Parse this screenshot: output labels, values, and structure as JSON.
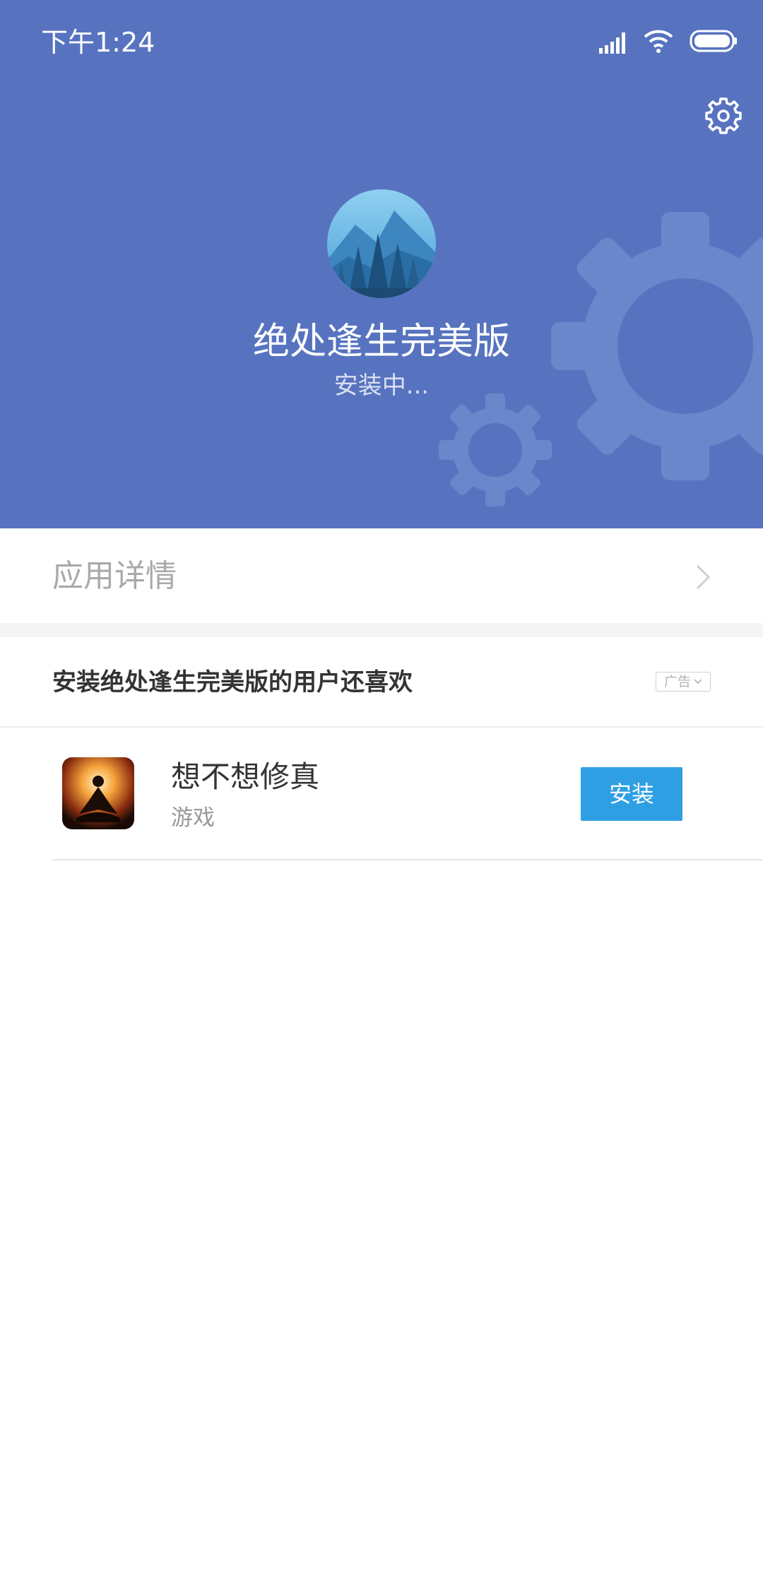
{
  "status_bar": {
    "time": "下午1:24",
    "icons": [
      "signal-icon",
      "wifi-icon",
      "battery-icon"
    ]
  },
  "header": {
    "app_name": "绝处逢生完美版",
    "install_status": "安装中...",
    "settings_icon": "gear-icon",
    "background_color": "#5773c0"
  },
  "details_row": {
    "label": "应用详情",
    "chevron_icon": "chevron-right-icon"
  },
  "recommendation": {
    "title": "安装绝处逢生完美版的用户还喜欢",
    "ad_label": "广告",
    "items": [
      {
        "name": "想不想修真",
        "category": "游戏",
        "button_label": "安装",
        "button_color": "#2f9fe4"
      }
    ]
  }
}
